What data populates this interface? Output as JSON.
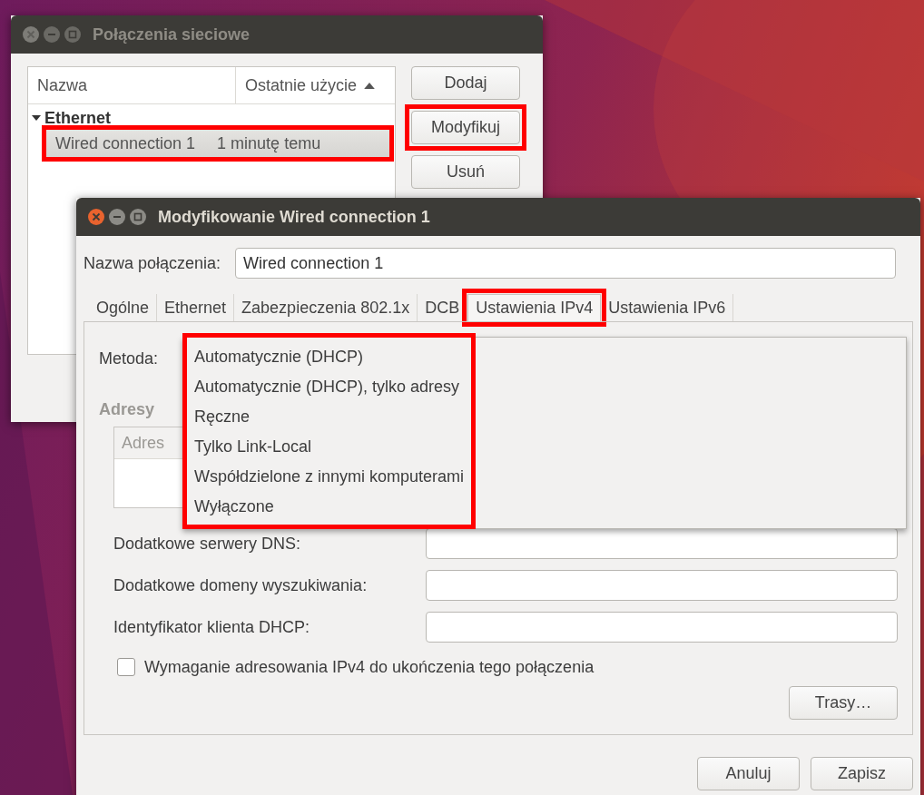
{
  "connections_window": {
    "title": "Połączenia sieciowe",
    "active": false,
    "columns": [
      "Nazwa",
      "Ostatnie użycie"
    ],
    "groups": [
      {
        "name": "Ethernet",
        "expanded": true,
        "connections": [
          {
            "name": "Wired connection 1",
            "last_used": "1 minutę temu",
            "selected": true,
            "highlighted": true
          }
        ]
      }
    ],
    "buttons": [
      {
        "label": "Dodaj",
        "highlighted": false
      },
      {
        "label": "Modyfikuj",
        "highlighted": true
      },
      {
        "label": "Usuń",
        "highlighted": false
      }
    ]
  },
  "edit_dialog": {
    "title": "Modyfikowanie Wired connection 1",
    "active": true,
    "name_label": "Nazwa połączenia:",
    "name_value": "Wired connection 1",
    "tabs": [
      {
        "label": "Ogólne",
        "selected": false,
        "highlighted": false
      },
      {
        "label": "Ethernet",
        "selected": false,
        "highlighted": false
      },
      {
        "label": "Zabezpieczenia 802.1x",
        "selected": false,
        "highlighted": false
      },
      {
        "label": "DCB",
        "selected": false,
        "highlighted": false
      },
      {
        "label": "Ustawienia IPv4",
        "selected": true,
        "highlighted": true
      },
      {
        "label": "Ustawienia IPv6",
        "selected": false,
        "highlighted": false
      }
    ],
    "method_label": "Metoda:",
    "method_menu": {
      "highlighted": true,
      "options": [
        "Automatycznie (DHCP)",
        "Automatycznie (DHCP), tylko adresy",
        "Ręczne",
        "Tylko Link-Local",
        "Współdzielone z innymi komputerami",
        "Wyłączone"
      ]
    },
    "addresses_label": "Adresy",
    "addresses_column": "Adres",
    "fields": [
      {
        "label": "Dodatkowe serwery DNS:"
      },
      {
        "label": "Dodatkowe domeny wyszukiwania:"
      },
      {
        "label": "Identyfikator klienta DHCP:"
      }
    ],
    "require_ipv4": {
      "label": "Wymaganie adresowania IPv4 do ukończenia tego połączenia",
      "checked": false
    },
    "routes_button": "Trasy…",
    "buttons": [
      "Anuluj",
      "Zapisz"
    ]
  }
}
